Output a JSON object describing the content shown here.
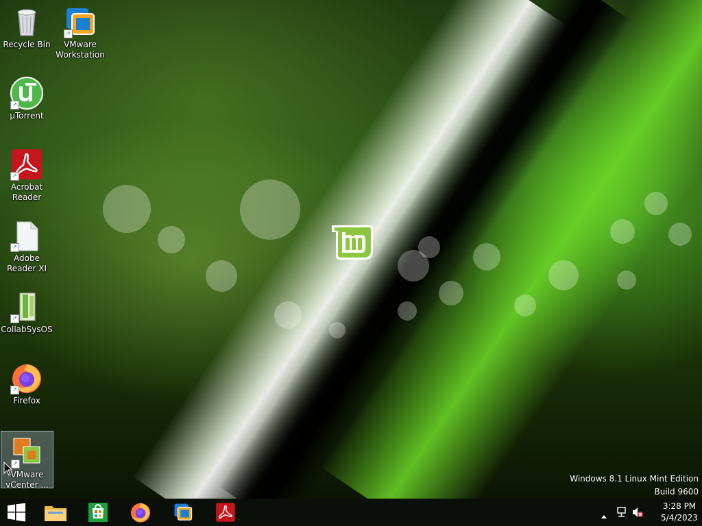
{
  "desktop": {
    "icons": [
      {
        "label": "Recycle Bin",
        "icon": "recycle-bin-icon"
      },
      {
        "label": "VMware Workstation",
        "icon": "vmware-workstation-icon"
      },
      {
        "label": "µTorrent",
        "icon": "utorrent-icon"
      },
      {
        "label": "Acrobat Reader",
        "icon": "acrobat-reader-icon"
      },
      {
        "label": "Adobe Reader XI",
        "icon": "document-file-icon"
      },
      {
        "label": "CollabSysOS",
        "icon": "collabsysos-icon"
      },
      {
        "label": "Firefox",
        "icon": "firefox-icon"
      },
      {
        "label": "VMware vCenter ...",
        "icon": "vmware-vcenter-icon",
        "selected": true
      }
    ]
  },
  "watermark": {
    "line1": "Windows 8.1 Linux Mint Edition",
    "line2": "Build 9600"
  },
  "taskbar": {
    "pinned": [
      {
        "name": "start-button",
        "icon": "windows-logo-icon"
      },
      {
        "name": "file-explorer",
        "icon": "folder-icon"
      },
      {
        "name": "store",
        "icon": "store-icon"
      },
      {
        "name": "firefox",
        "icon": "firefox-icon"
      },
      {
        "name": "vmware-workstation",
        "icon": "vmware-workstation-icon"
      },
      {
        "name": "acrobat-reader",
        "icon": "acrobat-reader-icon"
      }
    ],
    "tray": {
      "icons": [
        "chevron-up-icon",
        "network-icon",
        "volume-muted-icon"
      ],
      "time": "3:28 PM",
      "date": "5/4/2023"
    }
  },
  "colors": {
    "taskbar": "#0b0f0a",
    "mint_green": "#8cc63f",
    "store_green": "#1e9e3e",
    "acrobat_red": "#c4161c"
  }
}
